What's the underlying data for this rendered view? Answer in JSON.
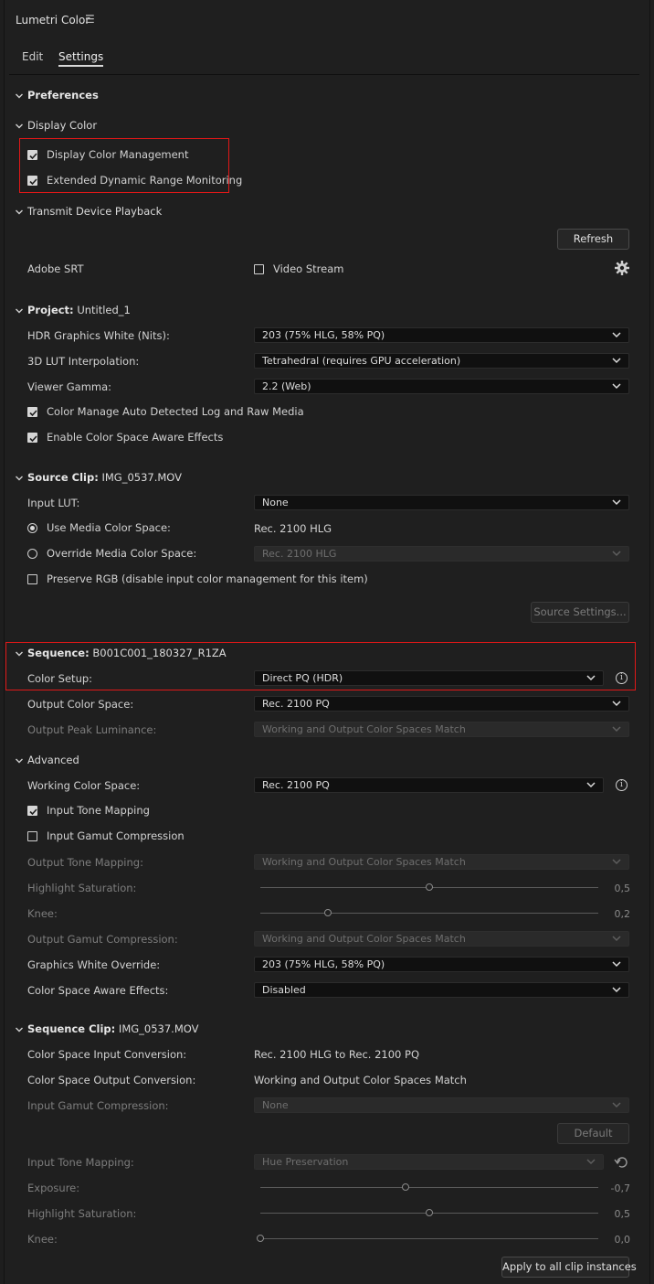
{
  "panel": {
    "title": "Lumetri Color",
    "tabs": [
      "Edit",
      "Settings"
    ],
    "active_tab": "Settings"
  },
  "sections": {
    "preferences": "Preferences",
    "display_color": "Display Color",
    "transmit": "Transmit Device Playback",
    "project_prefix": "Project:",
    "project_name": "Untitled_1",
    "source_prefix": "Source Clip:",
    "source_name": "IMG_0537.MOV",
    "sequence_prefix": "Sequence:",
    "sequence_name": "B001C001_180327_R1ZA",
    "advanced": "Advanced",
    "seqclip_prefix": "Sequence Clip:",
    "seqclip_name": "IMG_0537.MOV"
  },
  "display": {
    "color_management": "Display Color Management",
    "edr_monitoring": "Extended Dynamic Range Monitoring"
  },
  "transmit": {
    "refresh": "Refresh",
    "adobe_srt": "Adobe SRT",
    "video_stream": "Video Stream"
  },
  "project": {
    "hdr_white_label": "HDR Graphics White (Nits):",
    "hdr_white_value": "203 (75% HLG, 58% PQ)",
    "lut_interp_label": "3D LUT Interpolation:",
    "lut_interp_value": "Tetrahedral (requires GPU acceleration)",
    "gamma_label": "Viewer Gamma:",
    "gamma_value": "2.2 (Web)",
    "auto_log": "Color Manage Auto Detected Log and Raw Media",
    "aware_effects": "Enable Color Space Aware Effects"
  },
  "source": {
    "input_lut_label": "Input LUT:",
    "input_lut_value": "None",
    "use_media_label": "Use Media Color Space:",
    "use_media_value": "Rec. 2100 HLG",
    "override_label": "Override Media Color Space:",
    "override_value": "Rec. 2100 HLG",
    "preserve_rgb": "Preserve RGB (disable input color management for this item)",
    "source_settings": "Source Settings..."
  },
  "sequence": {
    "color_setup_label": "Color Setup:",
    "color_setup_value": "Direct PQ (HDR)",
    "output_space_label": "Output Color Space:",
    "output_space_value": "Rec. 2100 PQ",
    "peak_lum_label": "Output Peak Luminance:",
    "peak_lum_value": "Working and Output Color Spaces Match"
  },
  "advanced": {
    "working_space_label": "Working Color Space:",
    "working_space_value": "Rec. 2100 PQ",
    "input_tone_mapping": "Input Tone Mapping",
    "input_gamut": "Input Gamut Compression",
    "out_tone_label": "Output Tone Mapping:",
    "out_tone_value": "Working and Output Color Spaces Match",
    "highlight_sat_label": "Highlight Saturation:",
    "highlight_sat_value": "0,5",
    "highlight_sat_level": 0.5,
    "knee_label": "Knee:",
    "knee_value": "0,2",
    "knee_level": 0.2,
    "out_gamut_label": "Output Gamut Compression:",
    "out_gamut_value": "Working and Output Color Spaces Match",
    "gfx_override_label": "Graphics White Override:",
    "gfx_override_value": "203 (75% HLG, 58% PQ)",
    "aware_effects_label": "Color Space Aware Effects:",
    "aware_effects_value": "Disabled"
  },
  "seqclip": {
    "in_conv_label": "Color Space Input Conversion:",
    "in_conv_value": "Rec. 2100 HLG to Rec. 2100 PQ",
    "out_conv_label": "Color Space Output Conversion:",
    "out_conv_value": "Working and Output Color Spaces Match",
    "gamut_label": "Input Gamut Compression:",
    "gamut_value": "None",
    "default_btn": "Default",
    "tone_label": "Input Tone Mapping:",
    "tone_value": "Hue Preservation",
    "exposure_label": "Exposure:",
    "exposure_value": "-0,7",
    "exposure_level": 0.43,
    "hsat_label": "Highlight Saturation:",
    "hsat_value": "0,5",
    "hsat_level": 0.5,
    "knee_label": "Knee:",
    "knee_value": "0,0",
    "knee_level": 0.0,
    "apply_all": "Apply to all clip instances"
  },
  "colors": {
    "highlight_box": "#e01818",
    "panel_bg": "#1f1f1f",
    "dropdown_bg": "#101010"
  }
}
